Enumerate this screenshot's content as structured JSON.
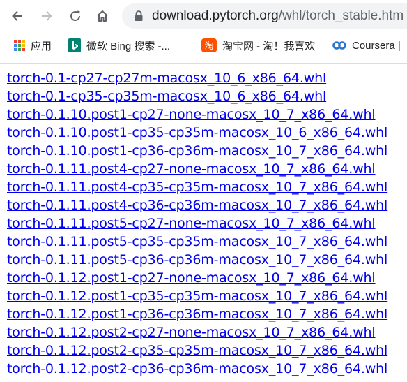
{
  "browser": {
    "url_host": "download.pytorch.org",
    "url_path": "/whl/torch_stable.htm",
    "bookmarks": [
      {
        "label": "应用",
        "icon": "apps-grid-icon"
      },
      {
        "label": "微软 Bing 搜索 -...",
        "icon": "bing-icon"
      },
      {
        "label": "淘宝网 - 淘！我喜欢",
        "icon": "taobao-icon"
      },
      {
        "label": "Coursera |",
        "icon": "coursera-icon"
      }
    ]
  },
  "links": [
    "torch-0.1-cp27-cp27m-macosx_10_6_x86_64.whl",
    "torch-0.1-cp35-cp35m-macosx_10_6_x86_64.whl",
    "torch-0.1.10.post1-cp27-none-macosx_10_7_x86_64.whl",
    "torch-0.1.10.post1-cp35-cp35m-macosx_10_6_x86_64.whl",
    "torch-0.1.10.post1-cp36-cp36m-macosx_10_7_x86_64.whl",
    "torch-0.1.11.post4-cp27-none-macosx_10_7_x86_64.whl",
    "torch-0.1.11.post4-cp35-cp35m-macosx_10_7_x86_64.whl",
    "torch-0.1.11.post4-cp36-cp36m-macosx_10_7_x86_64.whl",
    "torch-0.1.11.post5-cp27-none-macosx_10_7_x86_64.whl",
    "torch-0.1.11.post5-cp35-cp35m-macosx_10_7_x86_64.whl",
    "torch-0.1.11.post5-cp36-cp36m-macosx_10_7_x86_64.whl",
    "torch-0.1.12.post1-cp27-none-macosx_10_7_x86_64.whl",
    "torch-0.1.12.post1-cp35-cp35m-macosx_10_7_x86_64.whl",
    "torch-0.1.12.post1-cp36-cp36m-macosx_10_7_x86_64.whl",
    "torch-0.1.12.post2-cp27-none-macosx_10_7_x86_64.whl",
    "torch-0.1.12.post2-cp35-cp35m-macosx_10_7_x86_64.whl",
    "torch-0.1.12.post2-cp36-cp36m-macosx_10_7_x86_64.whl"
  ],
  "colors": {
    "link": "#0000ee",
    "icon": "#5f6368",
    "omnibox": "#f1f3f4"
  }
}
